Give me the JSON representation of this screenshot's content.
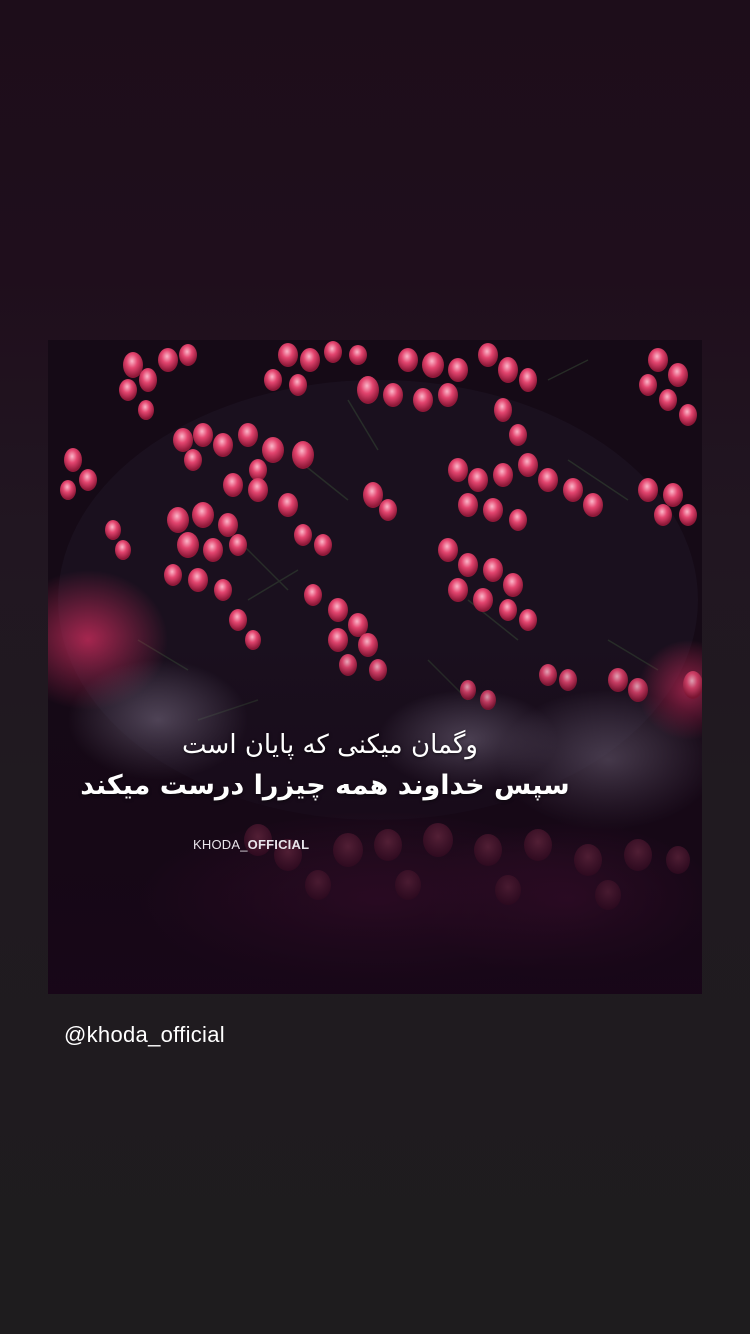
{
  "post": {
    "quote_line_1": "وگمان میکنی که پایان است",
    "quote_line_2": "سپس خداوند همه چیزرا درست میکند",
    "watermark_prefix": "KHODA_",
    "watermark_suffix": "OFFICIAL"
  },
  "story": {
    "mention": "@khoda_official"
  },
  "colors": {
    "background_top": "#1d0d1a",
    "background_bottom": "#1e1c1e",
    "flower_pink": "#e0406e",
    "flower_highlight": "#f7a6bd",
    "text": "#ffffff"
  }
}
